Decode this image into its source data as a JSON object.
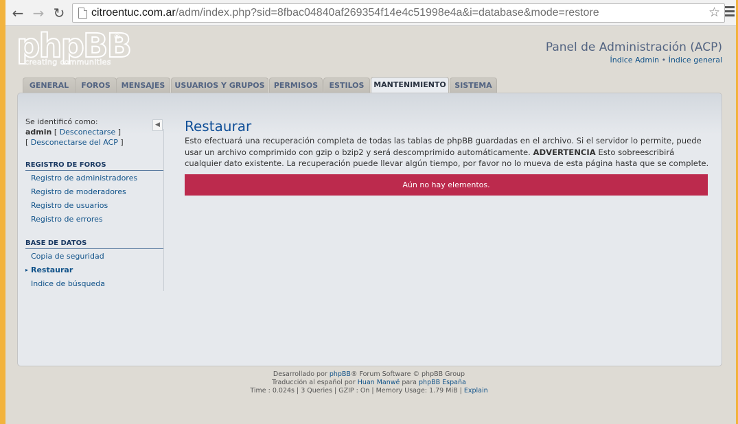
{
  "browser": {
    "url_host": "citroentuc.com.ar",
    "url_path": "/adm/index.php?sid=8fbac04840af269354f14e4c51998e4a&i=database&mode=restore"
  },
  "header": {
    "logo_text": "phpBB",
    "logo_tagline": "creating communities",
    "acp_title": "Panel de Administración (ACP)",
    "link_admin": "Índice Admin",
    "separator": "•",
    "link_general": "Índice general"
  },
  "tabs": [
    {
      "label": "GENERAL"
    },
    {
      "label": "FOROS"
    },
    {
      "label": "MENSAJES"
    },
    {
      "label": "USUARIOS Y GRUPOS"
    },
    {
      "label": "PERMISOS"
    },
    {
      "label": "ESTILOS"
    },
    {
      "label": "MANTENIMIENTO",
      "active": true
    },
    {
      "label": "SISTEMA"
    }
  ],
  "sidebar": {
    "identified_label": "Se identificó como:",
    "username": "admin",
    "logout_link": "Desconectarse",
    "logout_acp_link": "Desconectarse del ACP",
    "sections": [
      {
        "heading": "REGISTRO DE FOROS",
        "items": [
          "Registro de administradores",
          "Registro de moderadores",
          "Registro de usuarios",
          "Registro de errores"
        ]
      },
      {
        "heading": "BASE DE DATOS",
        "items": [
          "Copia de seguridad",
          "Restaurar",
          "Indice de búsqueda"
        ],
        "active_index": 1
      }
    ]
  },
  "main": {
    "title": "Restaurar",
    "desc_part1": "Esto efectuará una recuperación completa de todas las tablas de phpBB guardadas en el archivo. Si el servidor lo permite, puede usar un archivo comprimido con gzip o bzip2 y será descomprimido automáticamente.",
    "desc_warning": "ADVERTENCIA",
    "desc_part2": "Esto sobreescribirá cualquier dato existente. La recuperación puede llevar algún tiempo, por favor no lo mueva de esta página hasta que se complete.",
    "error_message": "Aún no hay elementos."
  },
  "footer": {
    "line1_prefix": "Desarrollado por",
    "line1_link": "phpBB",
    "line1_suffix": "® Forum Software © phpBB Group",
    "line2_prefix": "Traducción al español por",
    "line2_link1": "Huan Manwë",
    "line2_mid": "para",
    "line2_link2": "phpBB España",
    "line3": "Time : 0.024s | 3 Queries | GZIP : On | Memory Usage: 1.79 MiB |",
    "line3_link": "Explain"
  },
  "colors": {
    "tab_text": "#536482",
    "link": "#105289",
    "error_bg": "#bc2a4d",
    "title": "#115098"
  }
}
